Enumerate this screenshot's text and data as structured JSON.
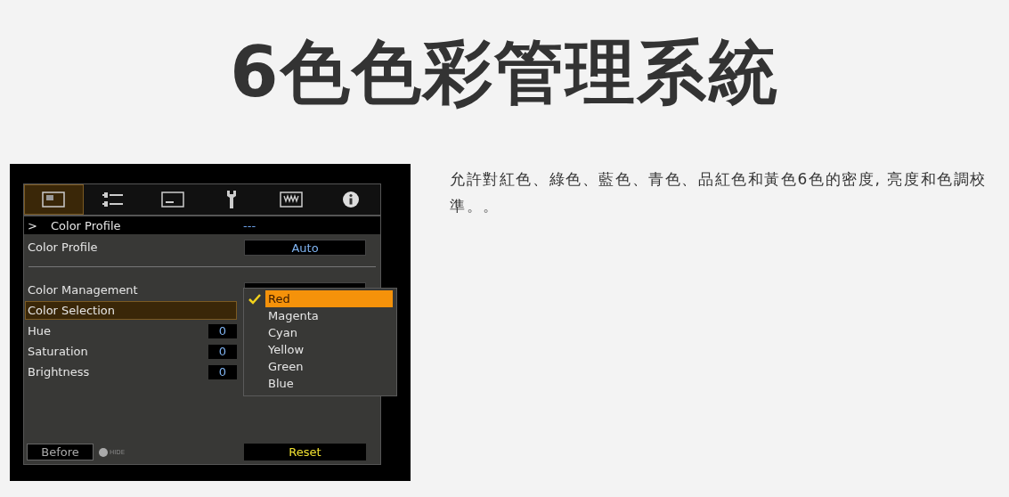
{
  "title": "6色色彩管理系統",
  "description": "允許對紅色、綠色、藍色、青色、品紅色和黃色6色的密度, 亮度和色調校準。。",
  "menu": {
    "tabs": [
      {
        "kind": "picture",
        "selected": true
      },
      {
        "kind": "sliders",
        "selected": false
      },
      {
        "kind": "screen",
        "selected": false
      },
      {
        "kind": "wrench",
        "selected": false
      },
      {
        "kind": "keypad",
        "selected": false
      },
      {
        "kind": "info",
        "selected": false
      }
    ],
    "header": {
      "marker": ">",
      "label": "Color Profile",
      "value": "---"
    },
    "profile_row": {
      "label": "Color Profile",
      "value": "Auto"
    },
    "rows": [
      {
        "kind": "select",
        "label": "Color Management",
        "selected": false
      },
      {
        "kind": "plain",
        "label": "Color Selection",
        "selected": true
      },
      {
        "kind": "number",
        "label": "Hue",
        "value": "0",
        "selected": false
      },
      {
        "kind": "number",
        "label": "Saturation",
        "value": "0",
        "selected": false
      },
      {
        "kind": "number",
        "label": "Brightness",
        "value": "0",
        "selected": false
      }
    ],
    "dropdown": [
      {
        "label": "Red",
        "checked": true,
        "selected": true
      },
      {
        "label": "Magenta",
        "checked": false,
        "selected": false
      },
      {
        "label": "Cyan",
        "checked": false,
        "selected": false
      },
      {
        "label": "Yellow",
        "checked": false,
        "selected": false
      },
      {
        "label": "Green",
        "checked": false,
        "selected": false
      },
      {
        "label": "Blue",
        "checked": false,
        "selected": false
      }
    ],
    "before_button": "Before",
    "hide_label": "HIDE",
    "reset_button": "Reset"
  }
}
